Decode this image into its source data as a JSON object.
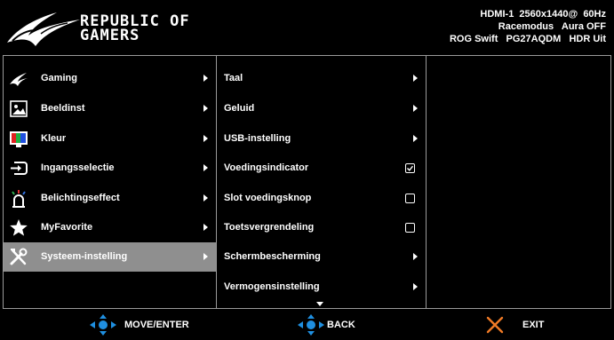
{
  "header": {
    "brand_line1": "REPUBLIC OF",
    "brand_line2": "GAMERS",
    "status_line1": "HDMI-1  2560x1440@  60Hz",
    "status_line2": "Racemodus   Aura OFF",
    "status_line3": "ROG Swift   PG27AQDM   HDR Uit"
  },
  "main_menu": [
    {
      "label": "Gaming",
      "icon": "rog-eye-icon"
    },
    {
      "label": "Beeldinst",
      "icon": "image-icon"
    },
    {
      "label": "Kleur",
      "icon": "color-icon"
    },
    {
      "label": "Ingangsselectie",
      "icon": "input-icon"
    },
    {
      "label": "Belichtingseffect",
      "icon": "light-icon"
    },
    {
      "label": "MyFavorite",
      "icon": "star-icon"
    },
    {
      "label": "Systeem-instelling",
      "icon": "tools-icon",
      "selected": true
    }
  ],
  "sub_menu": [
    {
      "label": "Taal",
      "control": "arrow"
    },
    {
      "label": "Geluid",
      "control": "arrow"
    },
    {
      "label": "USB-instelling",
      "control": "arrow"
    },
    {
      "label": "Voedingsindicator",
      "control": "checkbox",
      "checked": true
    },
    {
      "label": "Slot voedingsknop",
      "control": "checkbox",
      "checked": false
    },
    {
      "label": "Toetsvergrendeling",
      "control": "checkbox",
      "checked": false
    },
    {
      "label": "Schermbescherming",
      "control": "arrow"
    },
    {
      "label": "Vermogensinstelling",
      "control": "arrow"
    }
  ],
  "footer": {
    "move_label": "MOVE/ENTER",
    "back_label": "BACK",
    "exit_label": "EXIT"
  },
  "colors": {
    "background": "#000000",
    "selected": "#8f8f8f",
    "divider": "#9a9a9a",
    "nav_blue": "#1f8fe0",
    "exit_orange": "#f07a26"
  }
}
